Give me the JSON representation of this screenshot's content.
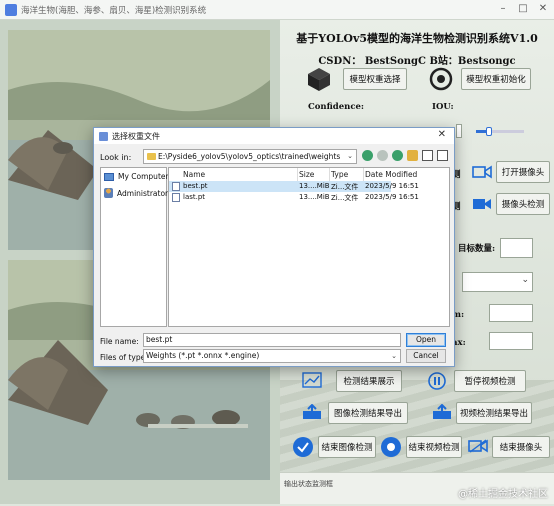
{
  "window": {
    "title": "海洋生物(海胆、海参、扇贝、海星)检测识别系统"
  },
  "app": {
    "title": "基于YOLOv5模型的海洋生物检测识别系统V1.0",
    "subtitle": "CSDN：  BestSongC   B站：Bestsongc",
    "buttons": {
      "select_weights": "模型权重选择",
      "init_weights": "模型权重初始化",
      "open_camera": "打开摄像头",
      "camera_detect": "摄像头检测",
      "show_results": "检测结果展示",
      "pause_video": "暂停视频检测",
      "export_image": "图像检测结果导出",
      "export_video": "视频检测结果导出",
      "end_image": "结束图像检测",
      "end_video": "结束视频检测",
      "end_camera": "结束摄像头"
    },
    "labels": {
      "confidence": "Confidence:",
      "iou": "IOU:",
      "target_count": "目标数量:",
      "partial_1": "测",
      "partial_2": "测",
      "partial_3": "m:",
      "partial_4": "ax:"
    },
    "status_text": "输出状态监测框",
    "watermark": "@稀土掘金技术社区"
  },
  "dialog": {
    "title": "选择权重文件",
    "look_in_label": "Look in:",
    "look_in_path": "E:\\Pyside6_yolov5\\yolov5_optics\\trained\\weights",
    "sidebar": [
      {
        "label": "My Computer"
      },
      {
        "label": "Administrator"
      }
    ],
    "columns": {
      "name": "Name",
      "size": "Size",
      "type": "Type",
      "date": "Date Modified"
    },
    "files": [
      {
        "name": "best.pt",
        "size": "13....MiB",
        "type": "Zi...文件",
        "date": "2023/5/9 16:51"
      },
      {
        "name": "last.pt",
        "size": "13....MiB",
        "type": "Zi...文件",
        "date": "2023/5/9 16:51"
      }
    ],
    "file_name_label": "File name:",
    "file_name_value": "best.pt",
    "file_type_label": "Files of type:",
    "file_type_value": "Weights (*.pt *.onnx *.engine)",
    "open_label": "Open",
    "cancel_label": "Cancel"
  }
}
